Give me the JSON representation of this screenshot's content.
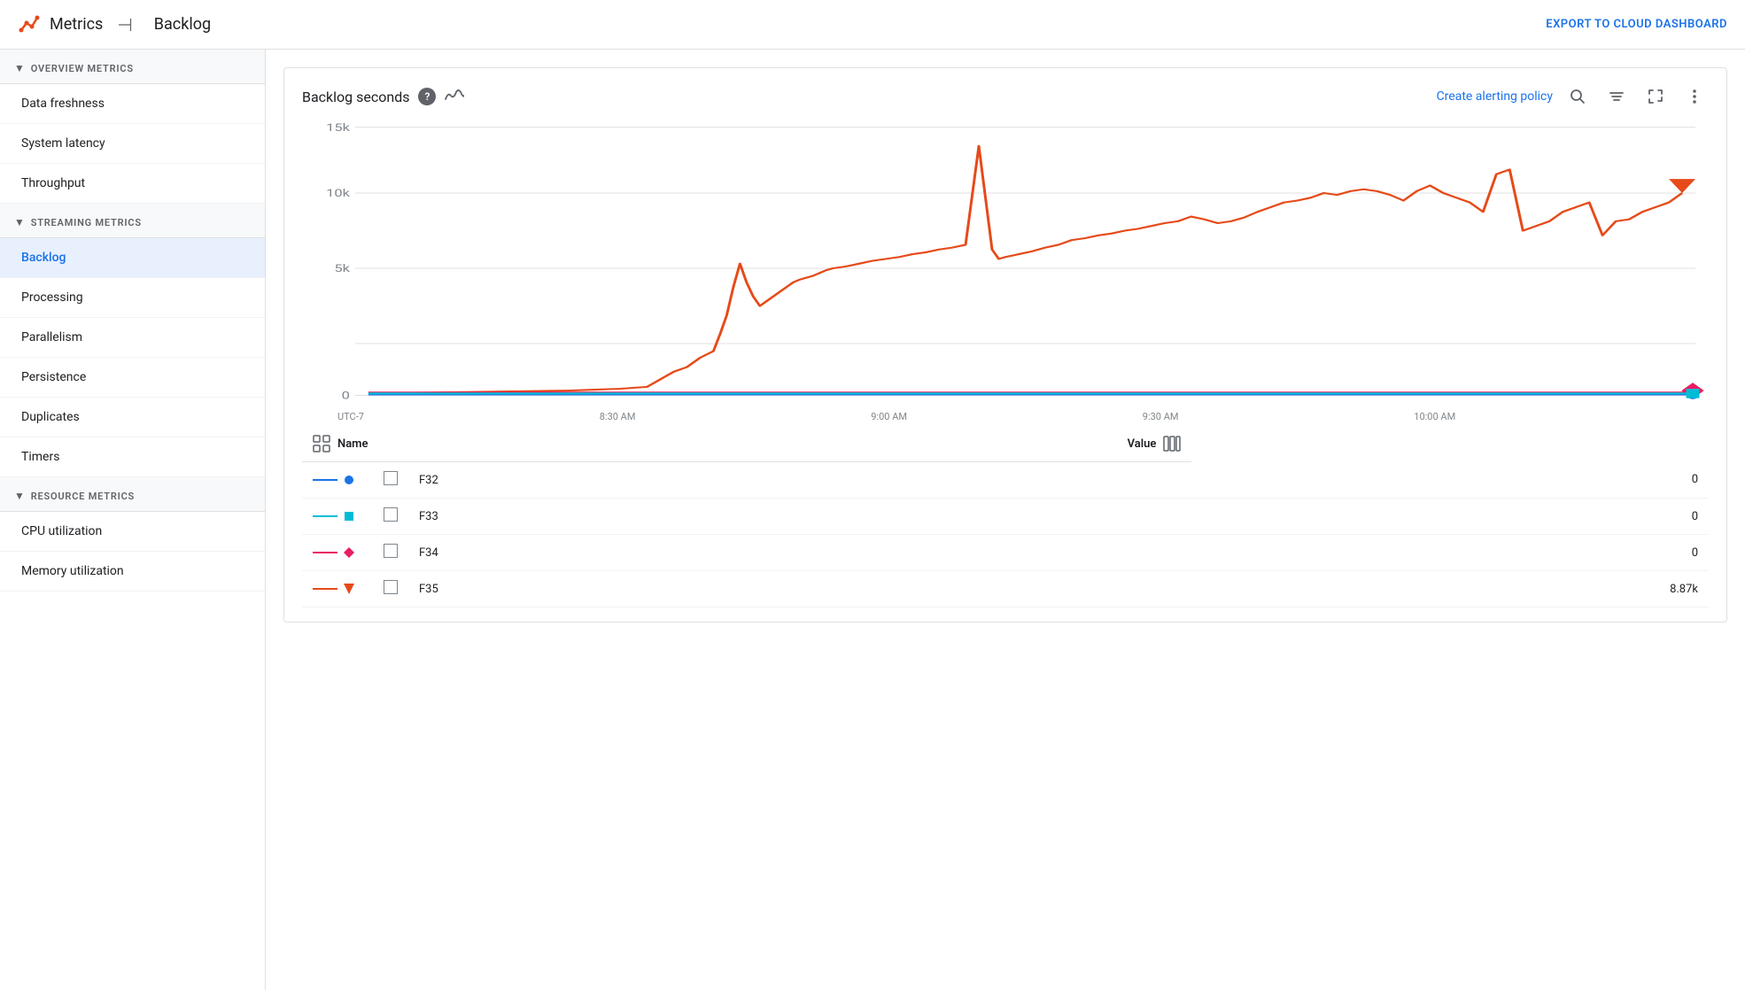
{
  "app": {
    "title": "Metrics",
    "logo_unicode": "📊",
    "collapse_icon": "⊣",
    "export_label": "EXPORT TO CLOUD DASHBOARD"
  },
  "header": {
    "page_title": "Backlog"
  },
  "sidebar": {
    "sections": [
      {
        "id": "overview",
        "label": "OVERVIEW METRICS",
        "items": [
          {
            "id": "data-freshness",
            "label": "Data freshness",
            "active": false
          },
          {
            "id": "system-latency",
            "label": "System latency",
            "active": false
          },
          {
            "id": "throughput",
            "label": "Throughput",
            "active": false
          }
        ]
      },
      {
        "id": "streaming",
        "label": "STREAMING METRICS",
        "items": [
          {
            "id": "backlog",
            "label": "Backlog",
            "active": true
          },
          {
            "id": "processing",
            "label": "Processing",
            "active": false
          },
          {
            "id": "parallelism",
            "label": "Parallelism",
            "active": false
          },
          {
            "id": "persistence",
            "label": "Persistence",
            "active": false
          },
          {
            "id": "duplicates",
            "label": "Duplicates",
            "active": false
          },
          {
            "id": "timers",
            "label": "Timers",
            "active": false
          }
        ]
      },
      {
        "id": "resource",
        "label": "RESOURCE METRICS",
        "items": [
          {
            "id": "cpu-utilization",
            "label": "CPU utilization",
            "active": false
          },
          {
            "id": "memory-utilization",
            "label": "Memory utilization",
            "active": false
          }
        ]
      }
    ]
  },
  "chart": {
    "title": "Backlog seconds",
    "help_tooltip": "?",
    "create_alert_label": "Create alerting policy",
    "y_labels": [
      "15k",
      "10k",
      "5k",
      "0"
    ],
    "x_labels": [
      "UTC-7",
      "8:30 AM",
      "9:00 AM",
      "9:30 AM",
      "10:00 AM",
      ""
    ],
    "legend": {
      "name_col": "Name",
      "value_col": "Value",
      "rows": [
        {
          "id": "F32",
          "name": "F32",
          "value": "0",
          "color_line": "#1a73e8",
          "color_dot": "#1a73e8",
          "shape": "dot"
        },
        {
          "id": "F33",
          "name": "F33",
          "value": "0",
          "color_line": "#00bcd4",
          "color_dot": "#00bcd4",
          "shape": "square"
        },
        {
          "id": "F34",
          "name": "F34",
          "value": "0",
          "color_line": "#e91e63",
          "color_dot": "#e91e63",
          "shape": "diamond"
        },
        {
          "id": "F35",
          "name": "F35",
          "value": "8.87k",
          "color_line": "#e64a19",
          "color_dot": "#e64a19",
          "shape": "triangle"
        }
      ]
    }
  }
}
